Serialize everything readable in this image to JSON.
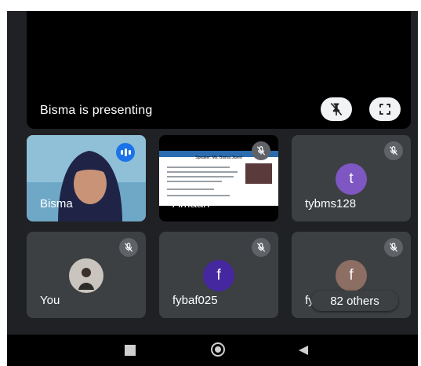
{
  "presentation": {
    "label": "Bisma is presenting"
  },
  "tiles": [
    {
      "name": "Bisma",
      "speaking": true
    },
    {
      "name": "Amaan",
      "muted": true,
      "slide_title": "Speaker: Ms. Bisma Javed"
    },
    {
      "name": "tybms128",
      "avatar_letter": "t",
      "avatar_color": "#7e57c2",
      "muted": true
    },
    {
      "name": "You",
      "muted": true
    },
    {
      "name": "fybaf025",
      "avatar_letter": "f",
      "avatar_color": "#4527a0",
      "muted": true
    },
    {
      "name": "fyb",
      "avatar_letter": "f",
      "avatar_color": "#8d6e63",
      "muted": true
    }
  ],
  "others": {
    "label": "82 others"
  },
  "colors": {
    "background": "#202124",
    "tile": "#3c4043",
    "speaking": "#1a73e8"
  }
}
